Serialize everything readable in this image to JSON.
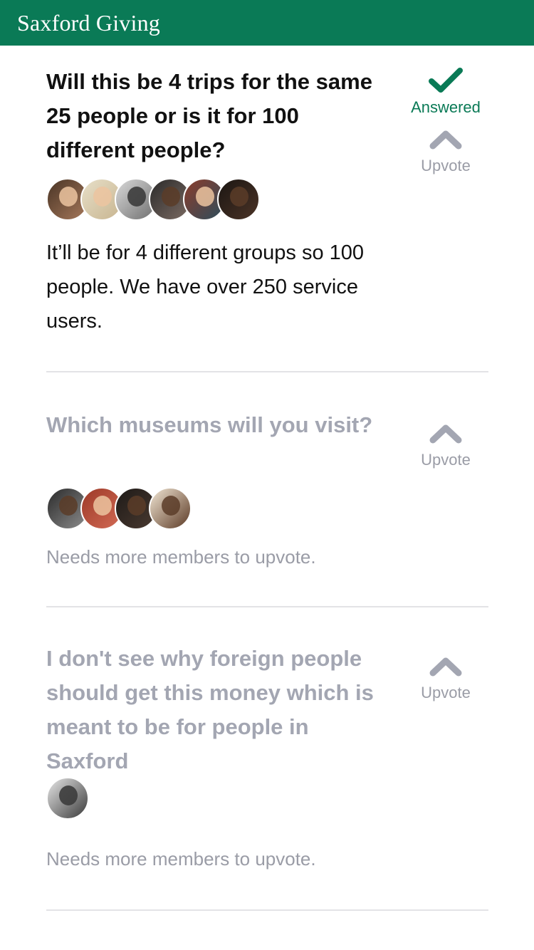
{
  "header": {
    "title": "Saxford Giving"
  },
  "colors": {
    "brand": "#0a7a56",
    "muted": "#a3a6b2",
    "divider": "#e3e3e6"
  },
  "questions": [
    {
      "text": "Will this be 4 trips for the same 25 people or is it for 100 different people?",
      "status": "Answered",
      "upvote_label": "Upvote",
      "answer": "It’ll be for 4 different groups so 100 people. We have over 250 service users.",
      "avatar_count": 6
    },
    {
      "text": "Which museums will you visit?",
      "upvote_label": "Upvote",
      "note": "Needs more members to upvote.",
      "avatar_count": 4
    },
    {
      "text": "I don't see why foreign people should get this money which is meant to be for people in Saxford",
      "upvote_label": "Upvote",
      "note": "Needs more members to upvote.",
      "avatar_count": 1
    }
  ]
}
